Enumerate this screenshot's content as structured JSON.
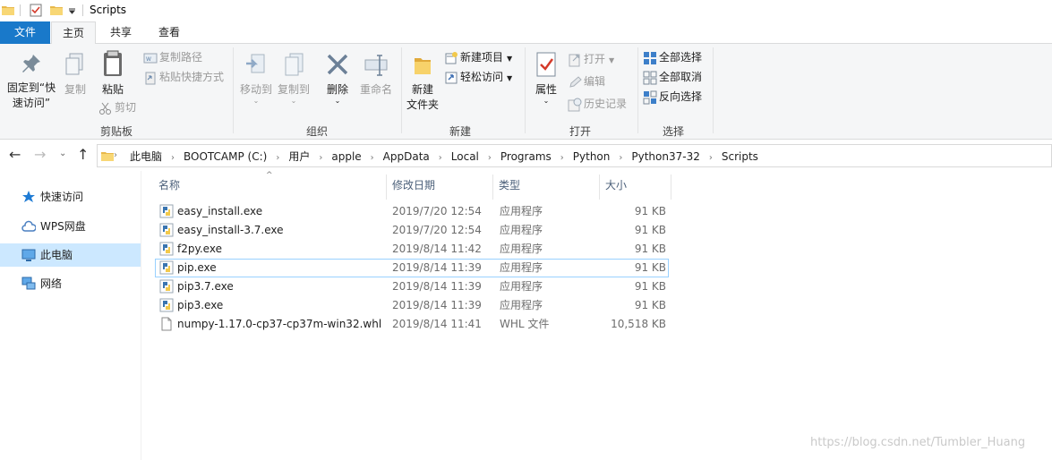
{
  "window": {
    "title": "Scripts"
  },
  "tabs": [
    {
      "label": "文件"
    },
    {
      "label": "主页"
    },
    {
      "label": "共享"
    },
    {
      "label": "查看"
    }
  ],
  "ribbon": {
    "clipboard": {
      "pin_line1": "固定到“快",
      "pin_line2": "速访问”",
      "copy": "复制",
      "paste": "粘贴",
      "copy_path": "复制路径",
      "paste_shortcut": "粘贴快捷方式",
      "cut": "剪切",
      "group": "剪贴板"
    },
    "organize": {
      "move_to": "移动到",
      "copy_to": "复制到",
      "delete": "删除",
      "rename": "重命名",
      "group": "组织"
    },
    "new": {
      "new_folder_line1": "新建",
      "new_folder_line2": "文件夹",
      "new_item": "新建项目",
      "easy_access": "轻松访问",
      "group": "新建"
    },
    "open": {
      "properties": "属性",
      "open": "打开",
      "edit": "编辑",
      "history": "历史记录",
      "group": "打开"
    },
    "select": {
      "select_all": "全部选择",
      "select_none": "全部取消",
      "invert": "反向选择",
      "group": "选择"
    }
  },
  "address": {
    "crumbs": [
      "此电脑",
      "BOOTCAMP (C:)",
      "用户",
      "apple",
      "AppData",
      "Local",
      "Programs",
      "Python",
      "Python37-32",
      "Scripts"
    ]
  },
  "navpane": {
    "items": [
      {
        "label": "快速访问"
      },
      {
        "label": "WPS网盘"
      },
      {
        "label": "此电脑"
      },
      {
        "label": "网络"
      }
    ]
  },
  "filelist": {
    "columns": {
      "name": "名称",
      "date": "修改日期",
      "type": "类型",
      "size": "大小"
    },
    "rows": [
      {
        "name": "easy_install.exe",
        "date": "2019/7/20 12:54",
        "type": "应用程序",
        "size": "91 KB"
      },
      {
        "name": "easy_install-3.7.exe",
        "date": "2019/7/20 12:54",
        "type": "应用程序",
        "size": "91 KB"
      },
      {
        "name": "f2py.exe",
        "date": "2019/8/14 11:42",
        "type": "应用程序",
        "size": "91 KB"
      },
      {
        "name": "pip.exe",
        "date": "2019/8/14 11:39",
        "type": "应用程序",
        "size": "91 KB"
      },
      {
        "name": "pip3.7.exe",
        "date": "2019/8/14 11:39",
        "type": "应用程序",
        "size": "91 KB"
      },
      {
        "name": "pip3.exe",
        "date": "2019/8/14 11:39",
        "type": "应用程序",
        "size": "91 KB"
      },
      {
        "name": "numpy-1.17.0-cp37-cp37m-win32.whl",
        "date": "2019/8/14 11:41",
        "type": "WHL 文件",
        "size": "10,518 KB"
      }
    ]
  },
  "watermark": "https://blog.csdn.net/Tumbler_Huang",
  "colors": {
    "accent": "#1979ca",
    "selected": "#cce8ff",
    "focus_border": "#99d1ff"
  }
}
